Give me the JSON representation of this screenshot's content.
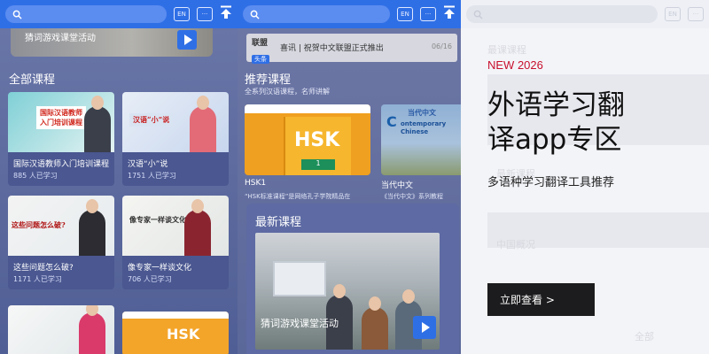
{
  "topbar": {
    "lang_label": "EN"
  },
  "panel1": {
    "banner_title": "猜词游戏课堂活动",
    "section_title": "全部课程",
    "cards": [
      {
        "title": "国际汉语教师入门培训课程",
        "learners": "885 人已学习",
        "thumb_text_1": "国际汉语教师",
        "thumb_text_2": "入门培训课程"
      },
      {
        "title": "汉语“小”说",
        "learners": "1751 人已学习",
        "thumb_text_1": "汉语“小”说"
      },
      {
        "title": "这些问题怎么破?",
        "learners": "1171 人已学习",
        "thumb_text_1": "这些问题怎么破?"
      },
      {
        "title": "像专家一样谈文化",
        "learners": "706 人已学习",
        "thumb_text_1": "像专家一样谈文化"
      }
    ],
    "bottom_thumb_right": "HSK"
  },
  "panel2": {
    "notice": {
      "logo_top": "联盟",
      "logo_bottom": "头条",
      "text": "喜讯 | 祝贺中文联盟正式推出",
      "date": "06/16"
    },
    "recommend_title": "推荐课程",
    "recommend_sub": "全系列汉语课程，名师讲解",
    "hsk_card": {
      "hsk_text": "HSK",
      "level": "1",
      "caption": "HSK1",
      "desc": "“HSK标准课程”是网络孔子学院精品在"
    },
    "dangdai_card": {
      "logo_big": "C",
      "logo_cn": "当代中文",
      "logo_en_1": "ontemporary",
      "logo_en_2": "Chinese",
      "caption": "当代中文",
      "desc": "《当代中文》系列教程"
    },
    "latest_title": "最新课程",
    "latest_video_title": "猜词游戏课堂活动"
  },
  "panel3": {
    "ghost_1": "最课课程",
    "ghost_2": "最新课程",
    "ghost_3": "中国概况",
    "ghost_4": "全部",
    "pretitle": "NEW 2026",
    "headline": "外语学习翻译app专区",
    "desc": "多语种学习翻译工具推荐",
    "cta": "立即查看 >"
  },
  "colors": {
    "accent": "#2f6fe6",
    "brand_red": "#c8102e"
  }
}
